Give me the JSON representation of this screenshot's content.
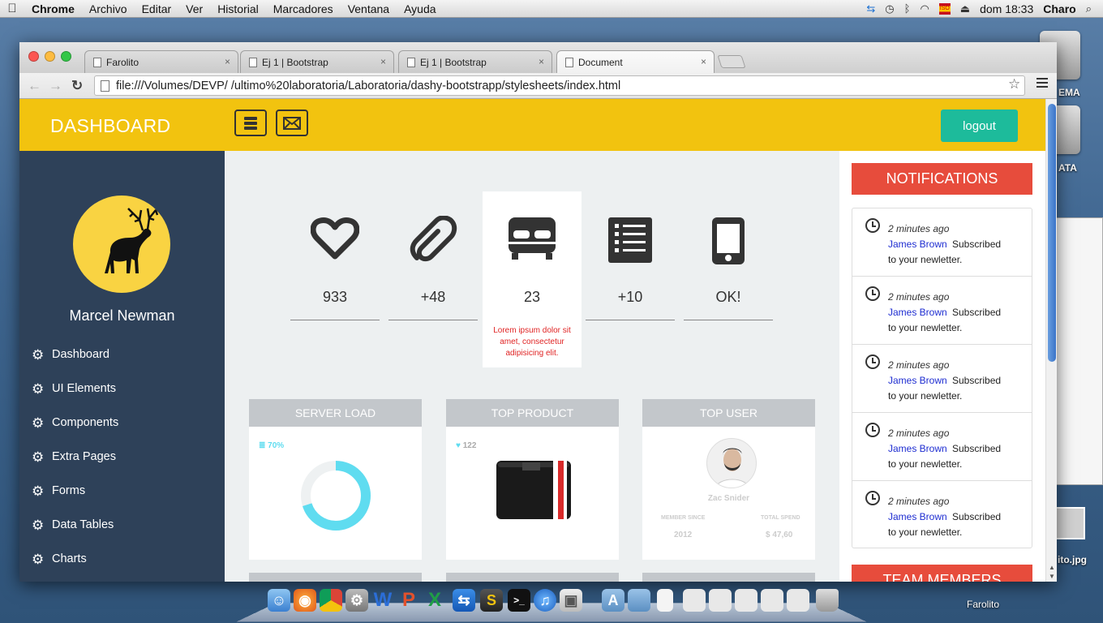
{
  "menubar": {
    "apple": "",
    "items": [
      "Chrome",
      "Archivo",
      "Editar",
      "Ver",
      "Historial",
      "Marcadores",
      "Ventana",
      "Ayuda"
    ],
    "clock": "dom 18:33",
    "user": "Charo",
    "flag_label": "ISO"
  },
  "desktop": {
    "drive1_label": "EMA",
    "drive2_label": "ATA",
    "file_label": "ito.jpg",
    "dock_label": "Farolito"
  },
  "browser": {
    "tabs": [
      {
        "title": "Farolito"
      },
      {
        "title": "Ej 1 | Bootstrap"
      },
      {
        "title": "Ej 1 | Bootstrap"
      },
      {
        "title": "Document"
      }
    ],
    "tab_close": "×",
    "url": "file:///Volumes/DEVP/ /ultimo%20laboratoria/Laboratoria/dashy-bootstrapp/stylesheets/index.html",
    "back": "←",
    "forward": "→",
    "reload": "↻",
    "star": "☆"
  },
  "header": {
    "brand": "DASHBOARD",
    "logout": "logout"
  },
  "sidebar": {
    "user_name": "Marcel Newman",
    "items": [
      {
        "label": "Dashboard"
      },
      {
        "label": "UI Elements"
      },
      {
        "label": "Components"
      },
      {
        "label": "Extra Pages"
      },
      {
        "label": "Forms"
      },
      {
        "label": "Data Tables"
      },
      {
        "label": "Charts"
      }
    ],
    "gear_glyph": "⚙"
  },
  "stats": [
    {
      "icon": "heart-icon",
      "value": "933"
    },
    {
      "icon": "paperclip-icon",
      "value": "+48"
    },
    {
      "icon": "bed-icon",
      "value": "23",
      "description": "Lorem ipsum dolor sit amet, consectetur adipisicing elit."
    },
    {
      "icon": "list-icon",
      "value": "+10"
    },
    {
      "icon": "mobile-icon",
      "value": "OK!"
    }
  ],
  "cards": {
    "server_load": {
      "title": "SERVER LOAD",
      "percent_label": "70%",
      "percent": 0.7
    },
    "top_product": {
      "title": "TOP PRODUCT",
      "likes": "122"
    },
    "top_user": {
      "title": "TOP USER",
      "name": "Zac Snider",
      "member_since_label": "MEMBER SINCE",
      "member_since": "2012",
      "total_spend_label": "TOTAL SPEND",
      "total_spend": "$ 47,60"
    }
  },
  "notifications": {
    "title": "NOTIFICATIONS",
    "items": [
      {
        "time": "2 minutes ago",
        "who": "James Brown",
        "action": "Subscribed",
        "action2": "to your newletter."
      },
      {
        "time": "2 minutes ago",
        "who": "James Brown",
        "action": "Subscribed",
        "action2": "to your newletter."
      },
      {
        "time": "2 minutes ago",
        "who": "James Brown",
        "action": "Subscribed",
        "action2": "to your newletter."
      },
      {
        "time": "2 minutes ago",
        "who": "James Brown",
        "action": "Subscribed",
        "action2": "to your newletter."
      },
      {
        "time": "2 minutes ago",
        "who": "James Brown",
        "action": "Subscribed",
        "action2": "to your newletter."
      }
    ]
  },
  "team_members": {
    "title": "TEAM MEMBERS"
  },
  "colors": {
    "header": "#f2c30f",
    "sidebar": "#2e4159",
    "logout": "#1dbb9b",
    "notifications": "#e74c3c",
    "donut": "#5fdcf0"
  }
}
